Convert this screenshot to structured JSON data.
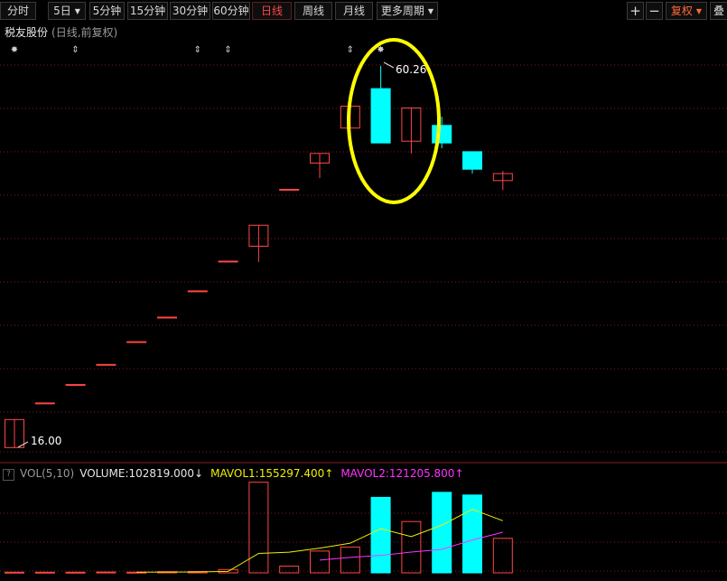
{
  "toolbar": {
    "fenshi": "分时",
    "day5": "5日",
    "min5": "5分钟",
    "min15": "15分钟",
    "min30": "30分钟",
    "min60": "60分钟",
    "daily": "日线",
    "weekly": "周线",
    "monthly": "月线",
    "more_periods": "更多周期",
    "plus": "+",
    "minus": "−",
    "fuquan": "复权",
    "overlay": "叠"
  },
  "stock": {
    "name": "税友股份",
    "subtitle": "(日线,前复权)"
  },
  "price_labels": {
    "high": "60.26",
    "low": "16.00"
  },
  "volume_panel": {
    "name": "VOL(5,10)",
    "volume": "VOLUME:102819.000",
    "mavol1": "MAVOL1:155297.400",
    "mavol2": "MAVOL2:121205.800"
  },
  "colors": {
    "up": "#ff4646",
    "down": "#00ffff",
    "ma1": "#f0f000",
    "ma2": "#ff33ff",
    "highlight_circle": "#ffff00",
    "grid": "#7a1c1c"
  },
  "chart_data": [
    {
      "type": "candlestick",
      "x": [
        1,
        2,
        3,
        4,
        5,
        6,
        7,
        8,
        9,
        10,
        11,
        12,
        13,
        14,
        15,
        16,
        17,
        18
      ],
      "candles": [
        {
          "open": 16.0,
          "close": 19.2,
          "high": 19.2,
          "low": 16.0
        },
        {
          "open": 21.1,
          "close": 21.1,
          "high": 21.1,
          "low": 21.1
        },
        {
          "open": 23.2,
          "close": 23.2,
          "high": 23.2,
          "low": 23.2
        },
        {
          "open": 25.5,
          "close": 25.5,
          "high": 25.5,
          "low": 25.5
        },
        {
          "open": 28.1,
          "close": 28.1,
          "high": 28.1,
          "low": 28.1
        },
        {
          "open": 30.9,
          "close": 30.9,
          "high": 30.9,
          "low": 30.9
        },
        {
          "open": 33.9,
          "close": 33.9,
          "high": 33.9,
          "low": 33.9
        },
        {
          "open": 37.3,
          "close": 37.3,
          "high": 37.3,
          "low": 37.3
        },
        {
          "open": 39.0,
          "close": 41.4,
          "high": 41.4,
          "low": 37.2
        },
        {
          "open": 45.5,
          "close": 45.5,
          "high": 45.5,
          "low": 45.5
        },
        {
          "open": 48.5,
          "close": 49.6,
          "high": 49.6,
          "low": 46.8
        },
        {
          "open": 52.5,
          "close": 55.0,
          "high": 55.0,
          "low": 52.5
        },
        {
          "open": 57.0,
          "close": 50.8,
          "high": 59.6,
          "low": 50.8
        },
        {
          "open": 51.0,
          "close": 54.8,
          "high": 54.8,
          "low": 49.6
        },
        {
          "open": 52.8,
          "close": 50.8,
          "high": 53.8,
          "low": 50.2
        },
        {
          "open": 49.8,
          "close": 47.8,
          "high": 49.8,
          "low": 47.3
        },
        {
          "open": 46.5,
          "close": 47.3,
          "high": 47.6,
          "low": 45.4
        }
      ],
      "price_range": [
        15,
        63
      ],
      "annotations": [
        {
          "x": 13,
          "label": "60.26"
        },
        {
          "x": 1,
          "label": "16.00"
        }
      ]
    },
    {
      "type": "bar",
      "series": [
        {
          "name": "VOLUME",
          "values": [
            2000,
            2000,
            2000,
            2500,
            2000,
            3500,
            4000,
            10000,
            270000,
            20000,
            65000,
            77000,
            225000,
            153000,
            240000,
            232000,
            102819
          ]
        },
        {
          "name": "MAVOL1",
          "values": [
            null,
            null,
            null,
            null,
            2100,
            2400,
            2800,
            4400,
            57900,
            61500,
            73800,
            88400,
            131400,
            108000,
            142000,
            189400,
            155297.4
          ]
        },
        {
          "name": "MAVOL2",
          "values": [
            null,
            null,
            null,
            null,
            null,
            null,
            null,
            null,
            null,
            null,
            38000,
            46000,
            52000,
            62000,
            70000,
            98000,
            121205.8
          ]
        }
      ],
      "ylim": [
        0,
        280000
      ]
    }
  ]
}
